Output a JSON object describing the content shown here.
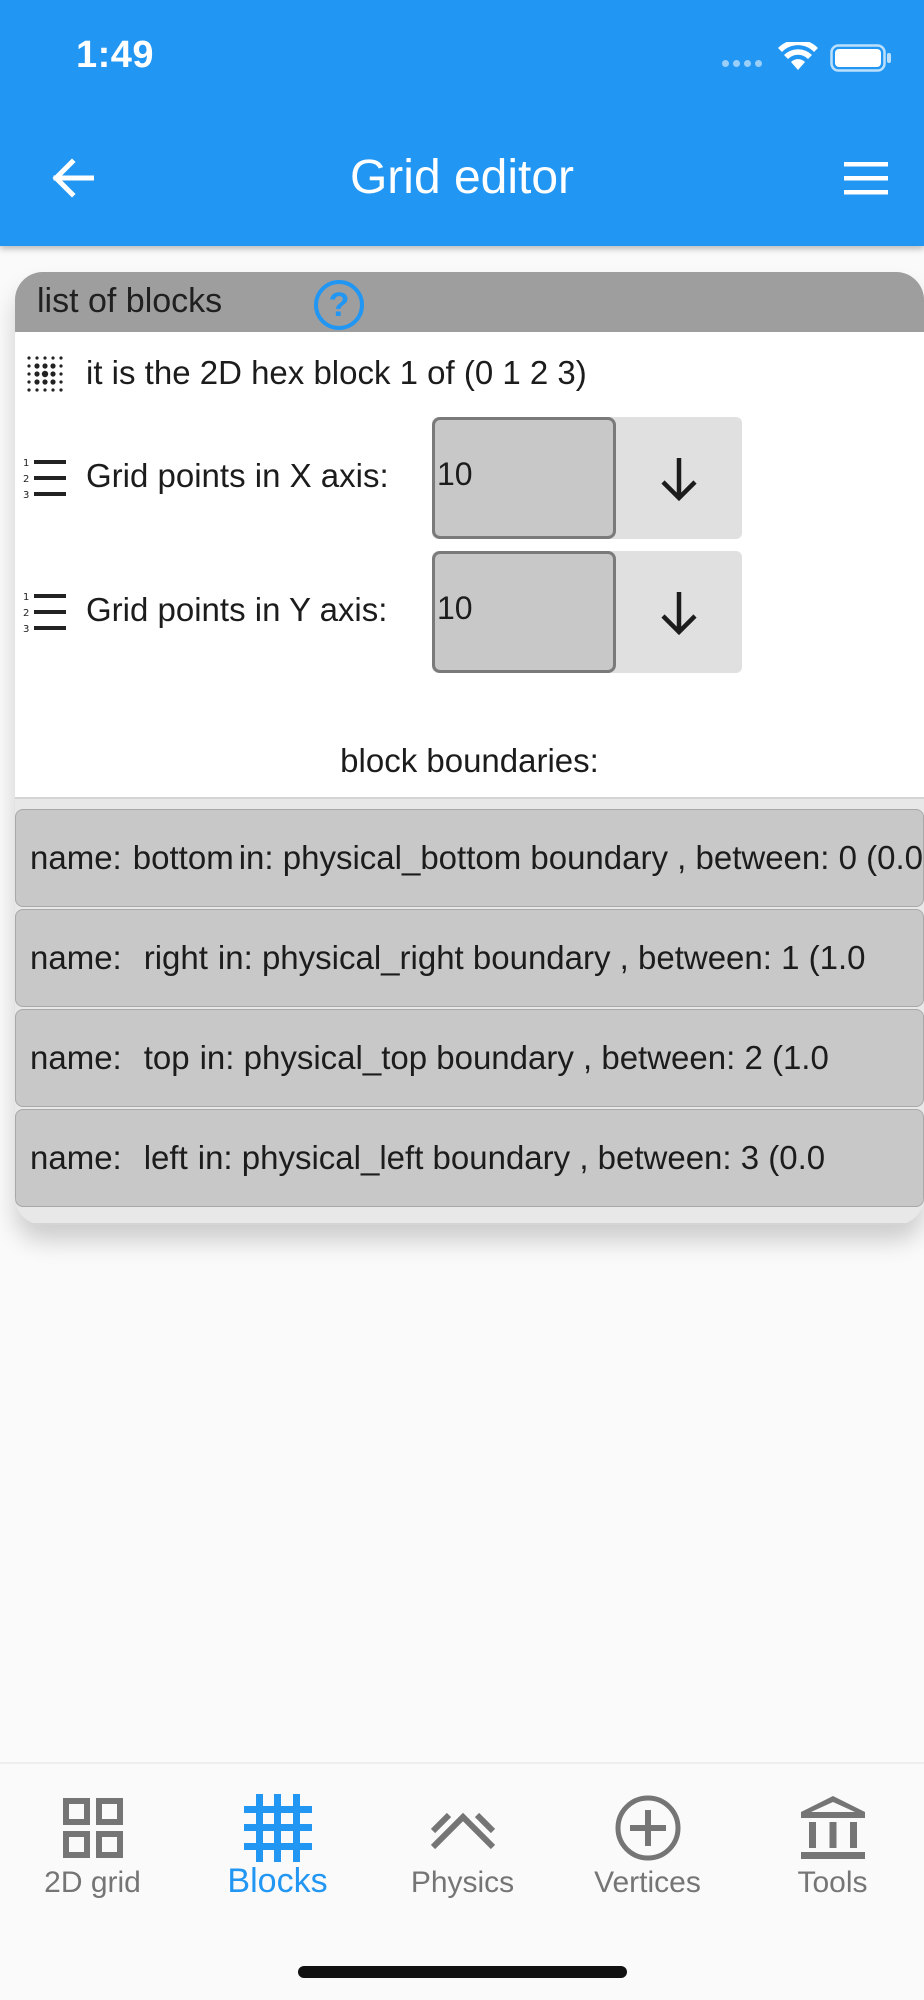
{
  "status_bar": {
    "time": "1:49"
  },
  "app_bar": {
    "title": "Grid editor"
  },
  "card": {
    "header_label": "list of blocks",
    "help_symbol": "?",
    "block_info": "it is the 2D hex block 1 of (0 1 2 3)",
    "grid_x": {
      "label": "Grid points in X axis:",
      "value": "10"
    },
    "grid_y": {
      "label": "Grid points in Y axis:",
      "value": "10"
    },
    "boundaries_title": "block boundaries:",
    "boundaries": [
      {
        "prefix": "name:",
        "name": "bottom",
        "rest": "in: physical_bottom boundary , between: 0 (0.0"
      },
      {
        "prefix": "name:",
        "name": "right",
        "rest": "in: physical_right boundary , between: 1 (1.0"
      },
      {
        "prefix": "name:",
        "name": "top",
        "rest": "in: physical_top boundary , between: 2 (1.0"
      },
      {
        "prefix": "name:",
        "name": "left",
        "rest": "in: physical_left boundary , between: 3 (0.0"
      }
    ]
  },
  "bottom_nav": {
    "active": "Blocks",
    "accent_color": "#2196f3",
    "items": [
      {
        "label": "2D grid",
        "icon": "grid-view-icon"
      },
      {
        "label": "Blocks",
        "icon": "hashtag-grid-icon"
      },
      {
        "label": "Physics",
        "icon": "double-chevron-up-icon"
      },
      {
        "label": "Vertices",
        "icon": "add-circle-icon"
      },
      {
        "label": "Tools",
        "icon": "bank-columns-icon"
      }
    ]
  },
  "colors": {
    "primary": "#2196f3",
    "card_header": "#9e9e9e",
    "boundary_item": "#c8c8c8"
  }
}
